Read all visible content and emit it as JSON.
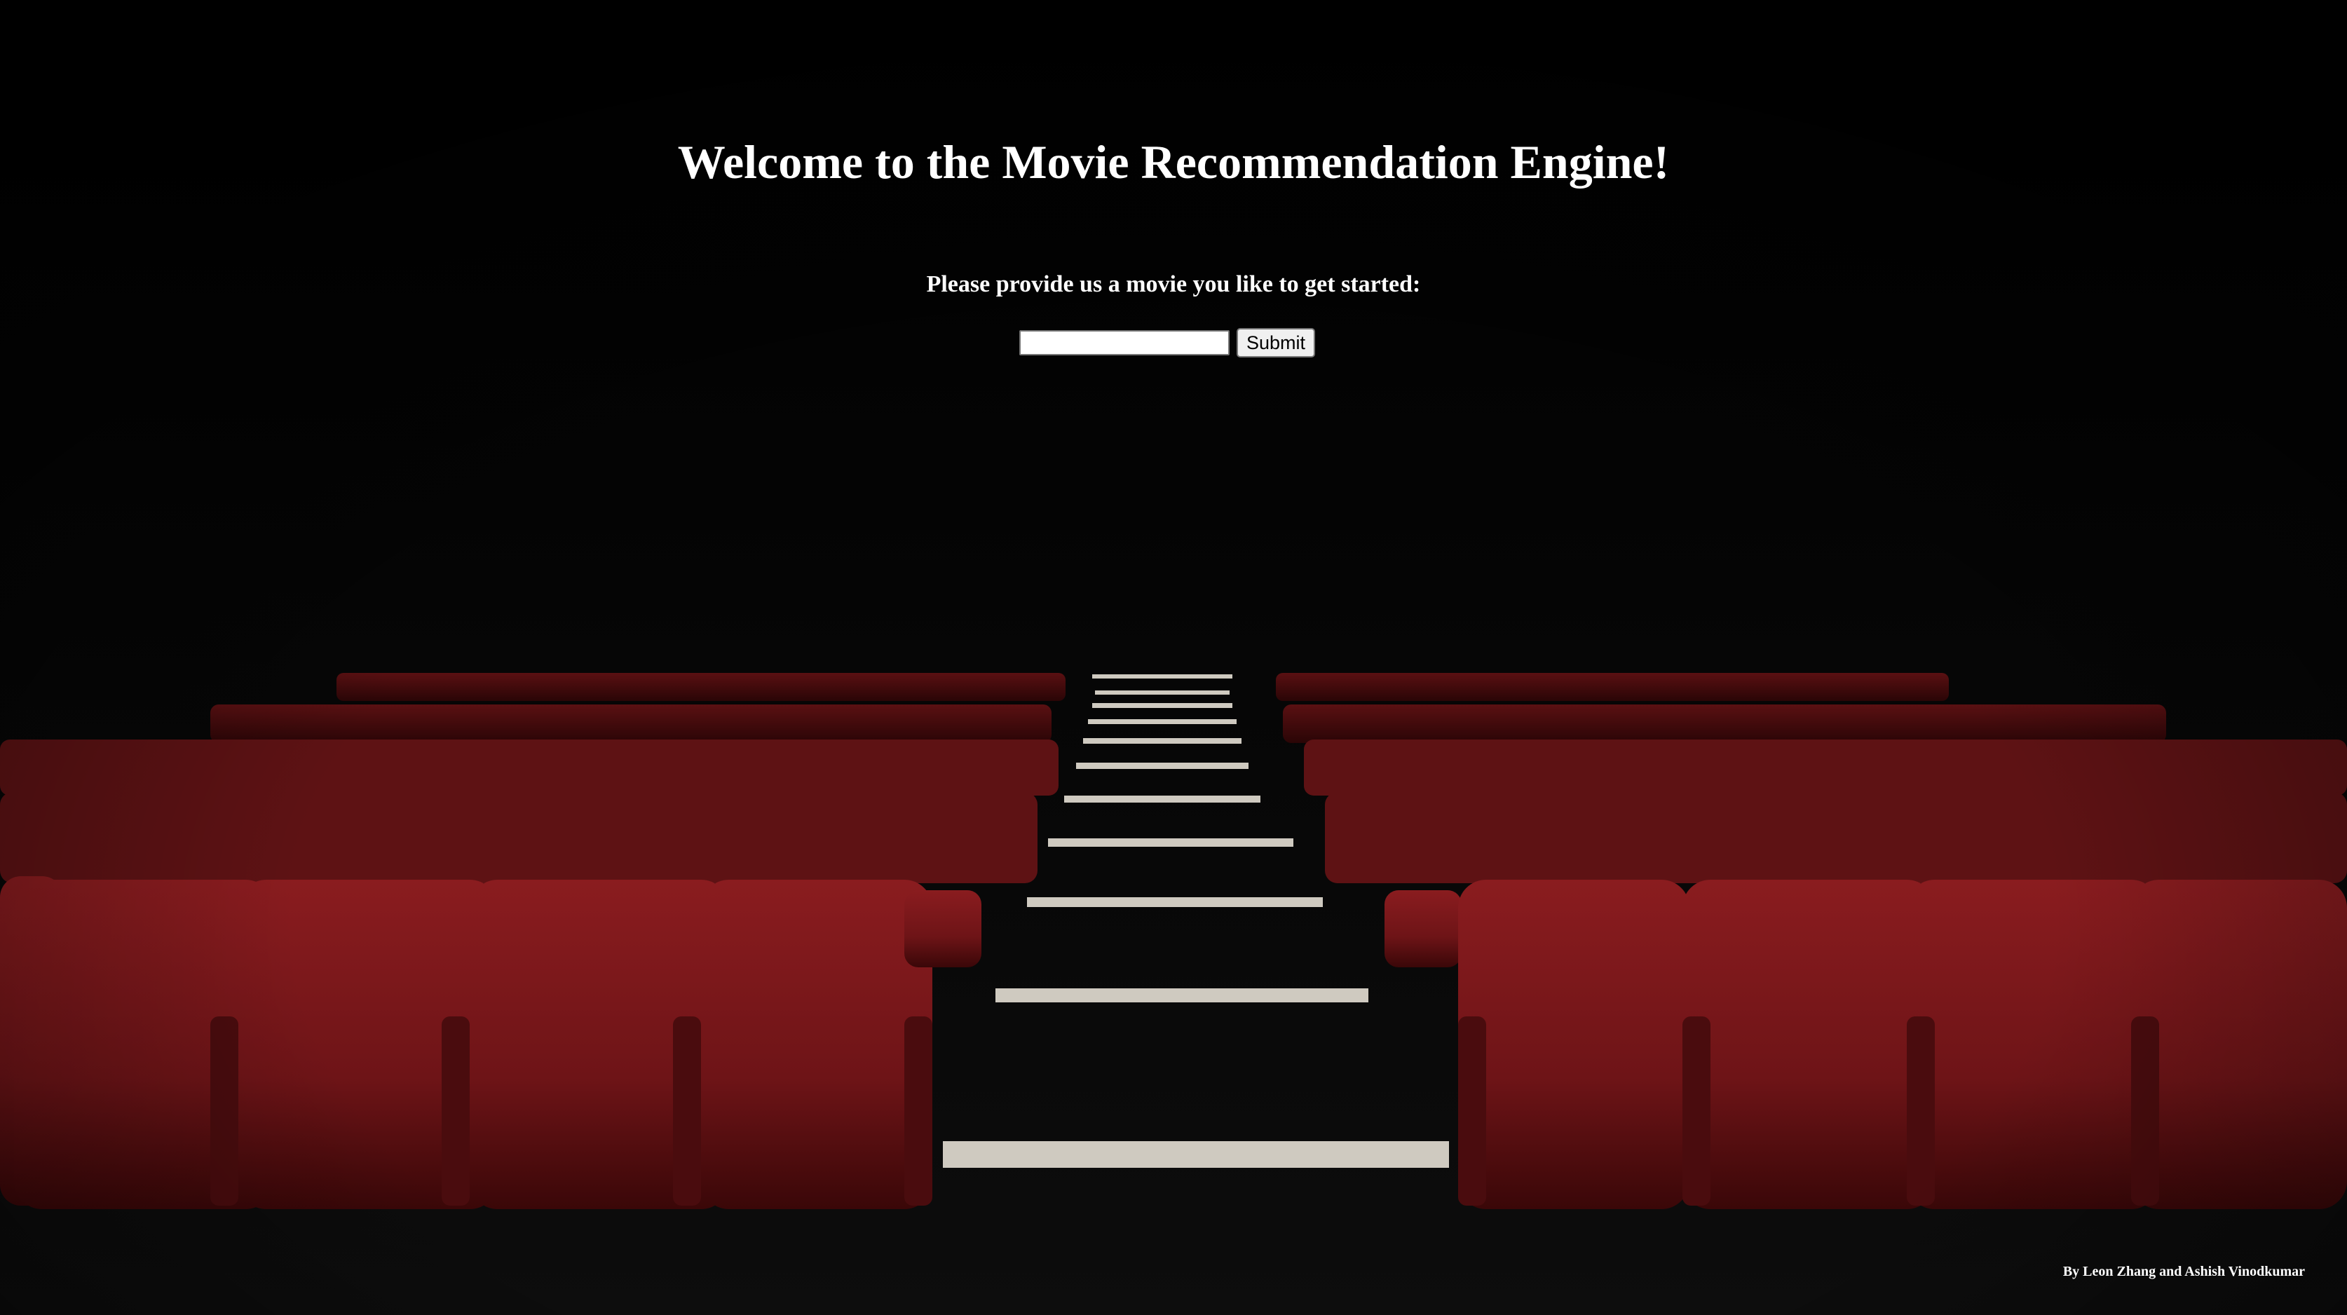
{
  "header": {
    "title": "Welcome to the Movie Recommendation Engine!"
  },
  "form": {
    "prompt": "Please provide us a movie you like to get started:",
    "movie_input_value": "",
    "movie_input_placeholder": "",
    "submit_label": "Submit"
  },
  "footer": {
    "credits": "By Leon Zhang and Ashish Vinodkumar"
  },
  "background": {
    "subject": "red-theater-seats",
    "colors": {
      "seat": "#7a1518",
      "seat_dark": "#3a0809",
      "stair_light": "#cfcac0",
      "backdrop": "#000000"
    }
  }
}
